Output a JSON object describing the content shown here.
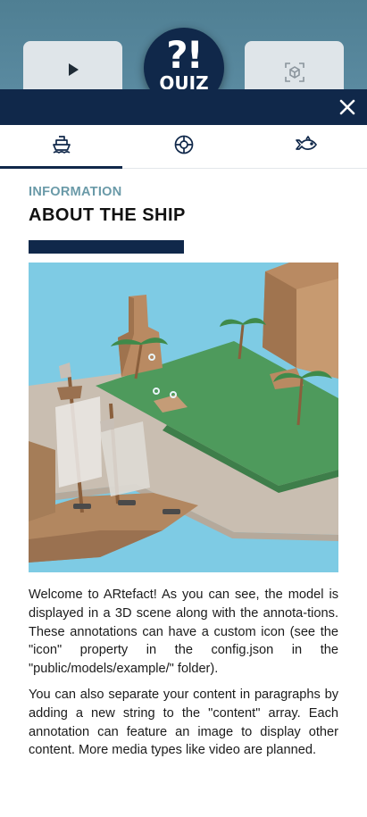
{
  "background": {
    "quiz_badge": {
      "symbol": "?!",
      "label": "QUIZ"
    },
    "left_button_icon": "play-icon",
    "right_button_icon": "ar-cube-icon"
  },
  "panel": {
    "close_icon": "close-icon",
    "tabs": [
      {
        "icon": "ship-icon",
        "active": true
      },
      {
        "icon": "lifebuoy-icon",
        "active": false
      },
      {
        "icon": "fish-icon",
        "active": false
      }
    ],
    "eyebrow": "INFORMATION",
    "title": "ABOUT THE SHIP",
    "image_alt": "3D low-poly scene of a pirate ship near an island",
    "paragraphs": [
      "Welcome to ARtefact! As you can see, the model is displayed in a 3D scene along with the annota-tions. These annotations can have a custom icon (see the \"icon\" property in the config.json in the \"public/models/example/\" folder).",
      "You can also separate your content in paragraphs by adding a new string to the \"content\" array. Each annotation can feature an image to display other content. More media types like video are planned."
    ]
  },
  "colors": {
    "navy": "#10284a",
    "eyebrow": "#6a9aa8",
    "water": "#7ecbe4",
    "grass": "#4e9a5c",
    "sand": "#c8bdb0",
    "rock": "#b98a62"
  }
}
